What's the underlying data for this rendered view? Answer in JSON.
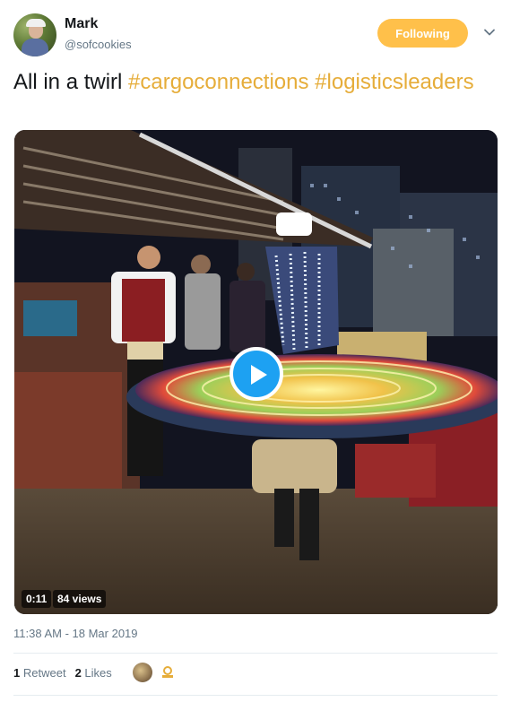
{
  "author": {
    "name": "Mark",
    "handle": "@sofcookies",
    "avatar_icon": "user-avatar"
  },
  "follow_button": {
    "label": "Following",
    "color": "#ffc04a"
  },
  "caret_icon": "chevron-down-icon",
  "tweet": {
    "text_plain": "All in a twirl",
    "hashtags": [
      "#cargoconnections",
      "#logisticsleaders"
    ]
  },
  "media": {
    "duration": "0:11",
    "views": "84 views",
    "description_icon": "play-icon"
  },
  "timestamp": "11:38 AM - 18 Mar 2019",
  "stats": {
    "retweet_count": "1",
    "retweet_label": "Retweet",
    "like_count": "2",
    "like_label": "Likes"
  },
  "colors": {
    "hashtag": "#e6ad3a",
    "play_button": "#1da1f2",
    "muted_text": "#657786"
  }
}
